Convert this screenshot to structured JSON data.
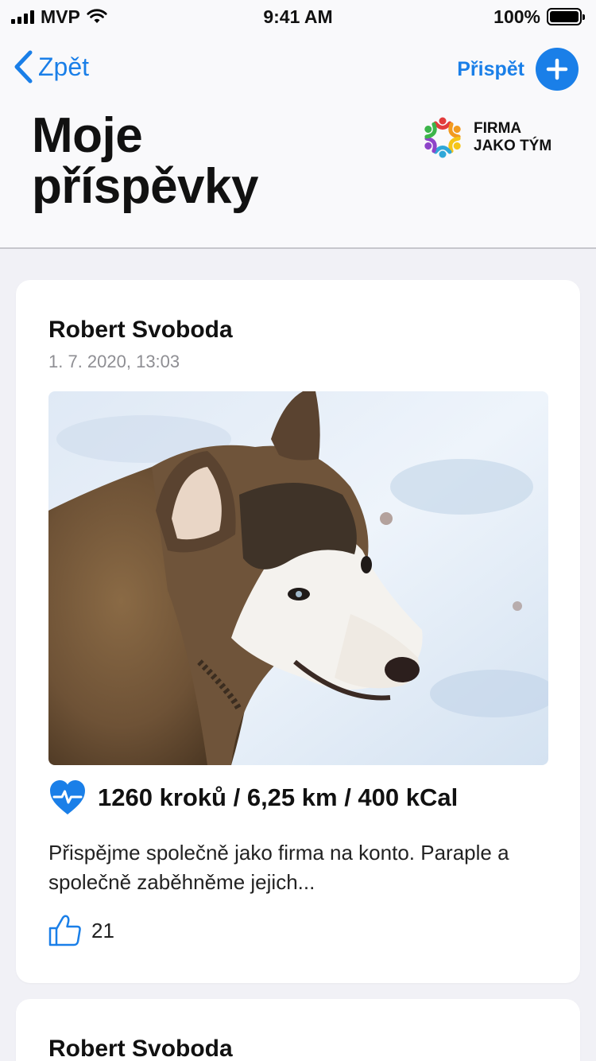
{
  "status_bar": {
    "carrier": "MVP",
    "time": "9:41 AM",
    "battery": "100%"
  },
  "header": {
    "back_label": "Zpět",
    "add_label": "Přispět",
    "title_line1": "Moje",
    "title_line2": "příspěvky",
    "logo_line1": "FIRMA",
    "logo_line2": "JAKO TÝM"
  },
  "colors": {
    "accent": "#1a7fe8",
    "secondary_text": "#8e8e93",
    "background": "#f1f1f6"
  },
  "posts": [
    {
      "author": "Robert Svoboda",
      "date": "1. 7. 2020, 13:03",
      "image": "husky-dog-photo",
      "stats_icon": "heart-pulse-icon",
      "stats": "1260 kroků / 6,25 km / 400 kCal",
      "description": "Přispějme společně jako firma na konto. Paraple a společně zaběhněme jejich...",
      "like_icon": "thumbs-up-icon",
      "likes": "21"
    },
    {
      "author": "Robert Svoboda"
    }
  ]
}
